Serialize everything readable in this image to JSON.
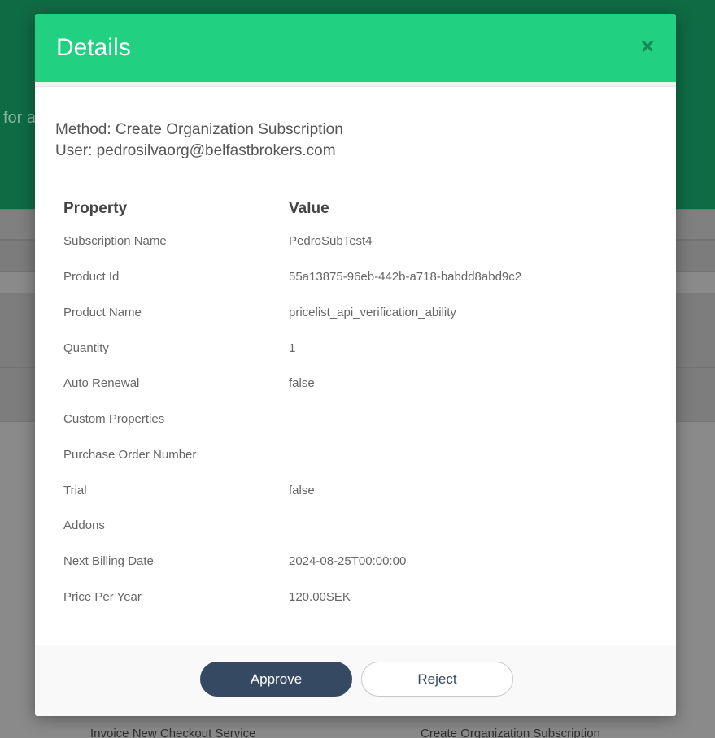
{
  "background": {
    "header_text": "for a",
    "bottom_left_text": "Invoice New Checkout Service",
    "bottom_right_text": "Create Organization Subscription"
  },
  "modal": {
    "title": "Details",
    "close_glyph": "×",
    "method_line": "Method: Create Organization Subscription",
    "user_line": "User: pedrosilvaorg@belfastbrokers.com",
    "table": {
      "headers": {
        "property": "Property",
        "value": "Value"
      },
      "rows": [
        {
          "property": "Subscription Name",
          "value": "PedroSubTest4"
        },
        {
          "property": "Product Id",
          "value": "55a13875-96eb-442b-a718-babdd8abd9c2"
        },
        {
          "property": "Product Name",
          "value": "pricelist_api_verification_ability"
        },
        {
          "property": "Quantity",
          "value": "1"
        },
        {
          "property": "Auto Renewal",
          "value": "false"
        },
        {
          "property": "Custom Properties",
          "value": ""
        },
        {
          "property": "Purchase Order Number",
          "value": ""
        },
        {
          "property": "Trial",
          "value": "false"
        },
        {
          "property": "Addons",
          "value": ""
        },
        {
          "property": "Next Billing Date",
          "value": "2024-08-25T00:00:00"
        },
        {
          "property": "Price Per Year",
          "value": "120.00SEK"
        }
      ]
    },
    "footer": {
      "approve_label": "Approve",
      "reject_label": "Reject"
    }
  },
  "colors": {
    "header_green": "#22d081",
    "close_icon": "#168a55",
    "approve_bg": "#354a62",
    "backdrop_header": "#0f6b44"
  }
}
